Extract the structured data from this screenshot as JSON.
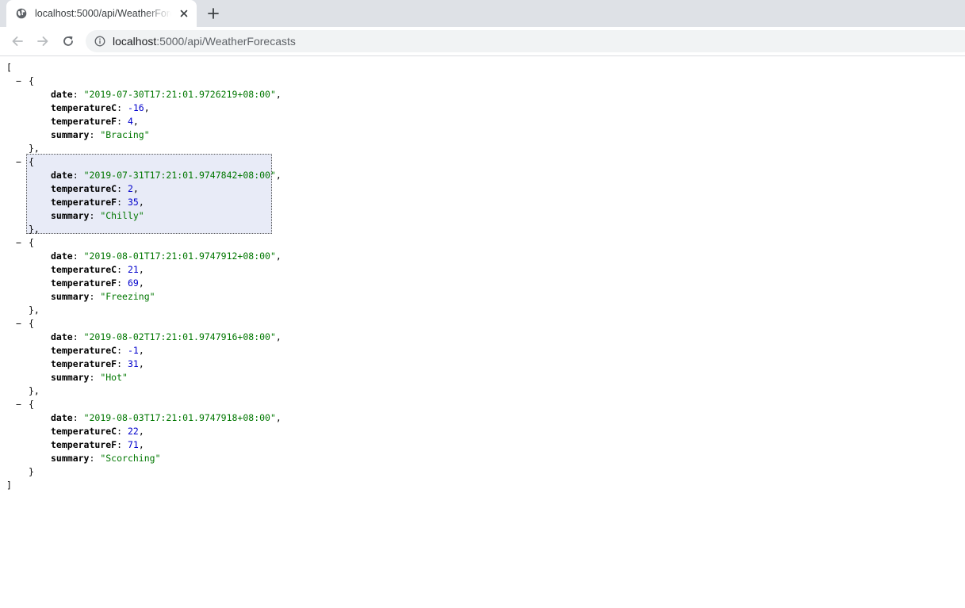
{
  "tab": {
    "title": "localhost:5000/api/WeatherForecasts",
    "favicon": "globe-icon",
    "close_icon": "close-icon"
  },
  "newtab_icon": "plus-icon",
  "toolbar": {
    "back_icon": "arrow-left-icon",
    "forward_icon": "arrow-right-icon",
    "reload_icon": "reload-icon",
    "info_icon": "info-icon",
    "url_host": "localhost",
    "url_rest": ":5000/api/WeatherForecasts"
  },
  "json": {
    "open_bracket": "[",
    "close_bracket": "]",
    "toggle_symbol": "−",
    "open_brace": "{",
    "close_brace_comma": "},",
    "close_brace": "}",
    "keys": {
      "date": "date",
      "temperatureC": "temperatureC",
      "temperatureF": "temperatureF",
      "summary": "summary"
    },
    "forecasts": [
      {
        "date": "\"2019-07-30T17:21:01.9726219+08:00\"",
        "temperatureC": "-16",
        "temperatureF": "4",
        "summary": "\"Bracing\""
      },
      {
        "date": "\"2019-07-31T17:21:01.9747842+08:00\"",
        "temperatureC": "2",
        "temperatureF": "35",
        "summary": "\"Chilly\""
      },
      {
        "date": "\"2019-08-01T17:21:01.9747912+08:00\"",
        "temperatureC": "21",
        "temperatureF": "69",
        "summary": "\"Freezing\""
      },
      {
        "date": "\"2019-08-02T17:21:01.9747916+08:00\"",
        "temperatureC": "-1",
        "temperatureF": "31",
        "summary": "\"Hot\""
      },
      {
        "date": "\"2019-08-03T17:21:01.9747918+08:00\"",
        "temperatureC": "22",
        "temperatureF": "71",
        "summary": "\"Scorching\""
      }
    ]
  },
  "colors": {
    "string": "#007700",
    "number": "#0000cc",
    "highlight": "#e8ebf7",
    "tabstrip": "#dee1e6",
    "omnibox": "#f1f3f4"
  }
}
